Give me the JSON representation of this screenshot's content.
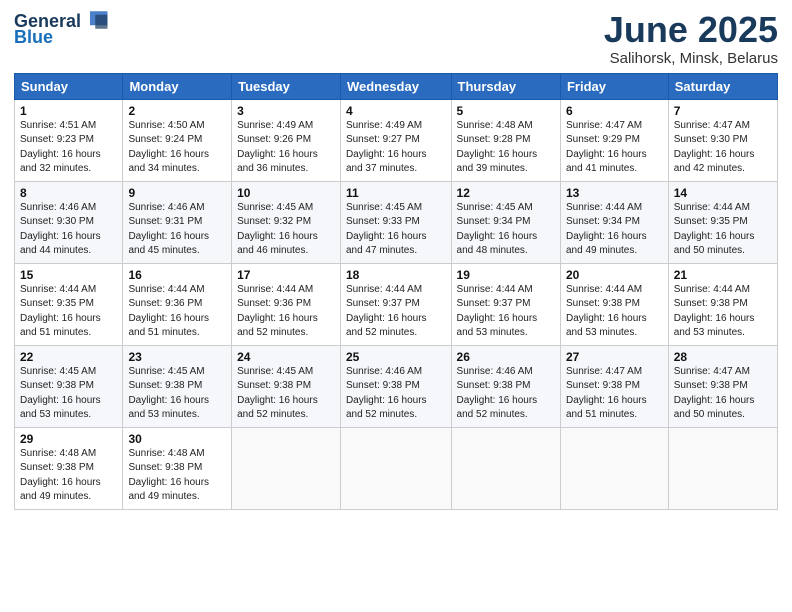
{
  "header": {
    "logo_line1": "General",
    "logo_line2": "Blue",
    "month_title": "June 2025",
    "location": "Salihorsk, Minsk, Belarus"
  },
  "days_of_week": [
    "Sunday",
    "Monday",
    "Tuesday",
    "Wednesday",
    "Thursday",
    "Friday",
    "Saturday"
  ],
  "weeks": [
    [
      {
        "day": "1",
        "sunrise": "4:51 AM",
        "sunset": "9:23 PM",
        "daylight": "16 hours and 32 minutes."
      },
      {
        "day": "2",
        "sunrise": "4:50 AM",
        "sunset": "9:24 PM",
        "daylight": "16 hours and 34 minutes."
      },
      {
        "day": "3",
        "sunrise": "4:49 AM",
        "sunset": "9:26 PM",
        "daylight": "16 hours and 36 minutes."
      },
      {
        "day": "4",
        "sunrise": "4:49 AM",
        "sunset": "9:27 PM",
        "daylight": "16 hours and 37 minutes."
      },
      {
        "day": "5",
        "sunrise": "4:48 AM",
        "sunset": "9:28 PM",
        "daylight": "16 hours and 39 minutes."
      },
      {
        "day": "6",
        "sunrise": "4:47 AM",
        "sunset": "9:29 PM",
        "daylight": "16 hours and 41 minutes."
      },
      {
        "day": "7",
        "sunrise": "4:47 AM",
        "sunset": "9:30 PM",
        "daylight": "16 hours and 42 minutes."
      }
    ],
    [
      {
        "day": "8",
        "sunrise": "4:46 AM",
        "sunset": "9:30 PM",
        "daylight": "16 hours and 44 minutes."
      },
      {
        "day": "9",
        "sunrise": "4:46 AM",
        "sunset": "9:31 PM",
        "daylight": "16 hours and 45 minutes."
      },
      {
        "day": "10",
        "sunrise": "4:45 AM",
        "sunset": "9:32 PM",
        "daylight": "16 hours and 46 minutes."
      },
      {
        "day": "11",
        "sunrise": "4:45 AM",
        "sunset": "9:33 PM",
        "daylight": "16 hours and 47 minutes."
      },
      {
        "day": "12",
        "sunrise": "4:45 AM",
        "sunset": "9:34 PM",
        "daylight": "16 hours and 48 minutes."
      },
      {
        "day": "13",
        "sunrise": "4:44 AM",
        "sunset": "9:34 PM",
        "daylight": "16 hours and 49 minutes."
      },
      {
        "day": "14",
        "sunrise": "4:44 AM",
        "sunset": "9:35 PM",
        "daylight": "16 hours and 50 minutes."
      }
    ],
    [
      {
        "day": "15",
        "sunrise": "4:44 AM",
        "sunset": "9:35 PM",
        "daylight": "16 hours and 51 minutes."
      },
      {
        "day": "16",
        "sunrise": "4:44 AM",
        "sunset": "9:36 PM",
        "daylight": "16 hours and 51 minutes."
      },
      {
        "day": "17",
        "sunrise": "4:44 AM",
        "sunset": "9:36 PM",
        "daylight": "16 hours and 52 minutes."
      },
      {
        "day": "18",
        "sunrise": "4:44 AM",
        "sunset": "9:37 PM",
        "daylight": "16 hours and 52 minutes."
      },
      {
        "day": "19",
        "sunrise": "4:44 AM",
        "sunset": "9:37 PM",
        "daylight": "16 hours and 53 minutes."
      },
      {
        "day": "20",
        "sunrise": "4:44 AM",
        "sunset": "9:38 PM",
        "daylight": "16 hours and 53 minutes."
      },
      {
        "day": "21",
        "sunrise": "4:44 AM",
        "sunset": "9:38 PM",
        "daylight": "16 hours and 53 minutes."
      }
    ],
    [
      {
        "day": "22",
        "sunrise": "4:45 AM",
        "sunset": "9:38 PM",
        "daylight": "16 hours and 53 minutes."
      },
      {
        "day": "23",
        "sunrise": "4:45 AM",
        "sunset": "9:38 PM",
        "daylight": "16 hours and 53 minutes."
      },
      {
        "day": "24",
        "sunrise": "4:45 AM",
        "sunset": "9:38 PM",
        "daylight": "16 hours and 52 minutes."
      },
      {
        "day": "25",
        "sunrise": "4:46 AM",
        "sunset": "9:38 PM",
        "daylight": "16 hours and 52 minutes."
      },
      {
        "day": "26",
        "sunrise": "4:46 AM",
        "sunset": "9:38 PM",
        "daylight": "16 hours and 52 minutes."
      },
      {
        "day": "27",
        "sunrise": "4:47 AM",
        "sunset": "9:38 PM",
        "daylight": "16 hours and 51 minutes."
      },
      {
        "day": "28",
        "sunrise": "4:47 AM",
        "sunset": "9:38 PM",
        "daylight": "16 hours and 50 minutes."
      }
    ],
    [
      {
        "day": "29",
        "sunrise": "4:48 AM",
        "sunset": "9:38 PM",
        "daylight": "16 hours and 49 minutes."
      },
      {
        "day": "30",
        "sunrise": "4:48 AM",
        "sunset": "9:38 PM",
        "daylight": "16 hours and 49 minutes."
      },
      null,
      null,
      null,
      null,
      null
    ]
  ]
}
